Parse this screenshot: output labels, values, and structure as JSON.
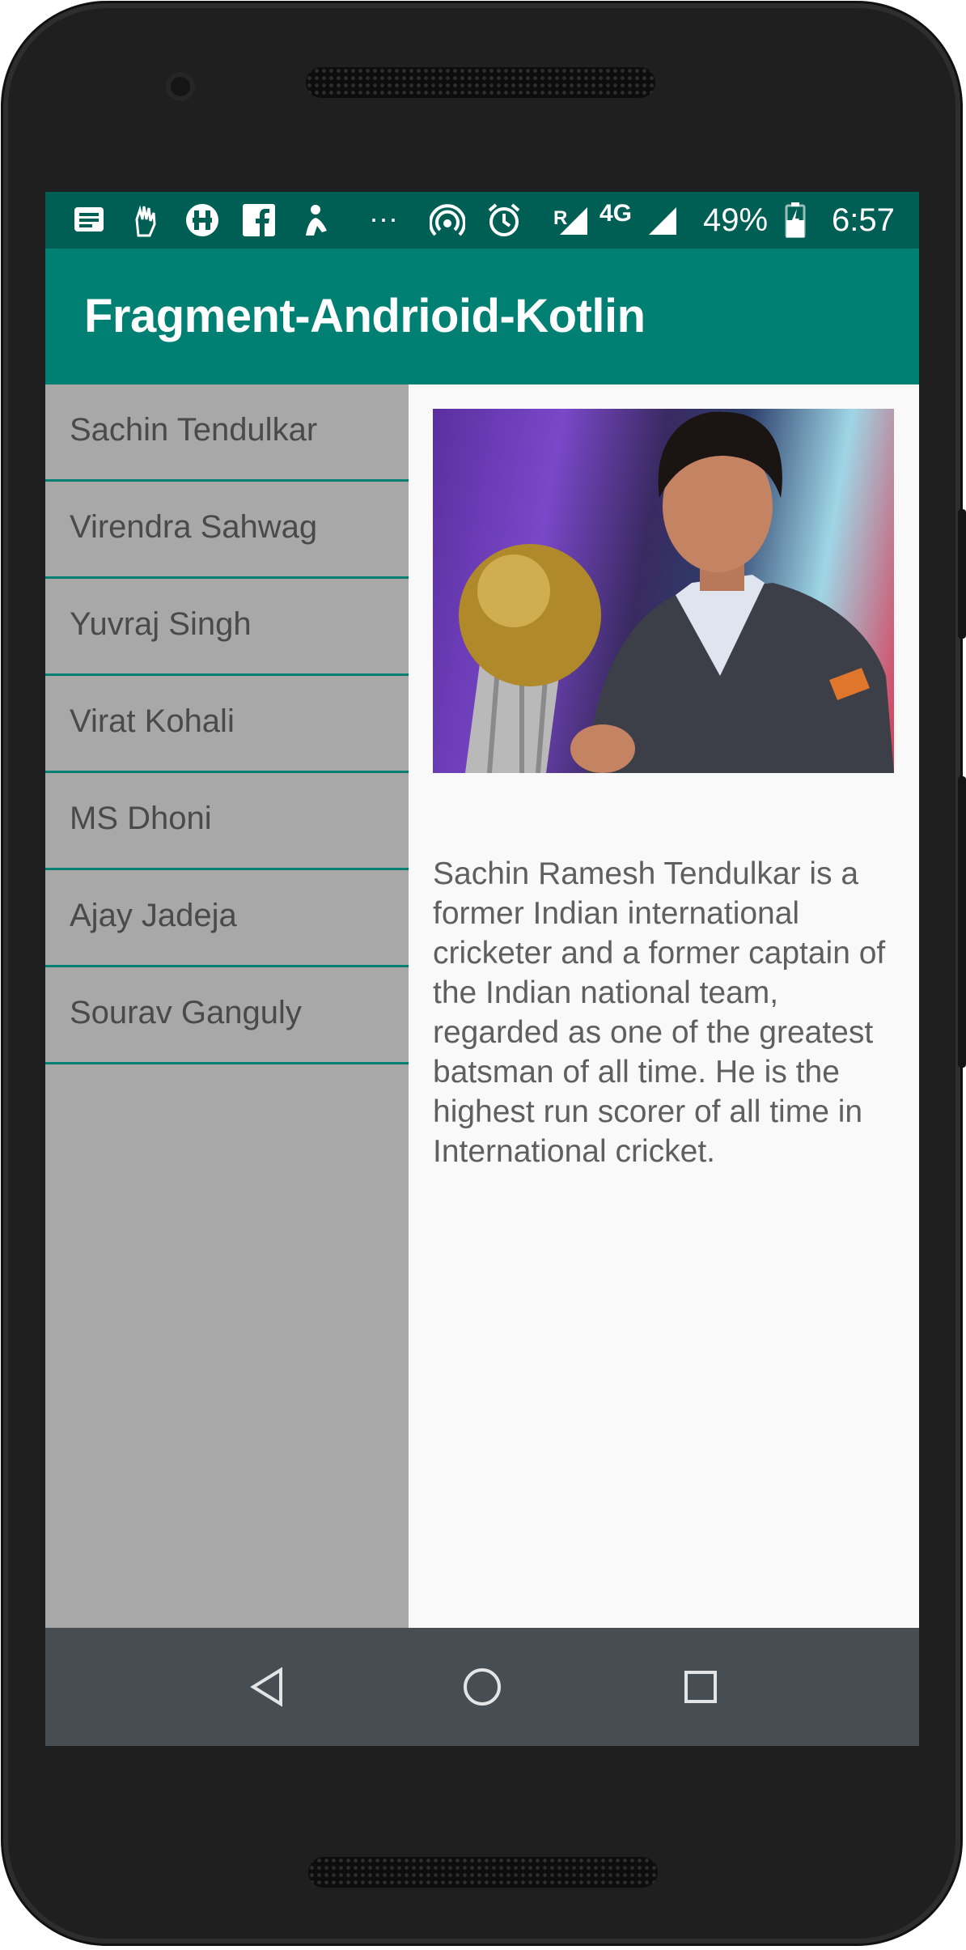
{
  "status_bar": {
    "icons": [
      "notes-icon",
      "hand-icon",
      "hotstar-icon",
      "facebook-icon",
      "cricket-icon",
      "more-notifications-icon",
      "hotspot-icon",
      "alarm-icon",
      "signal-roaming-icon",
      "signal-icon",
      "battery-icon"
    ],
    "roaming_label": "R",
    "network_label": "4G",
    "battery": "49%",
    "time": "6:57",
    "more": "···"
  },
  "app_bar": {
    "title": "Fragment-Andrioid-Kotlin",
    "color": "#008073"
  },
  "players": [
    {
      "name": "Sachin Tendulkar"
    },
    {
      "name": "Virendra Sahwag"
    },
    {
      "name": "Yuvraj Singh"
    },
    {
      "name": "Virat Kohali"
    },
    {
      "name": "MS Dhoni"
    },
    {
      "name": "Ajay Jadeja"
    },
    {
      "name": "Sourav Ganguly"
    }
  ],
  "detail": {
    "description": "Sachin Ramesh Tendulkar is a former Indian international cricketer and a former captain of the Indian national team, regarded as one of the greatest batsman of all time. He is the highest run scorer of all time in International cricket."
  },
  "nav_bar": {
    "icons": [
      "back-icon",
      "home-icon",
      "recents-icon"
    ]
  }
}
